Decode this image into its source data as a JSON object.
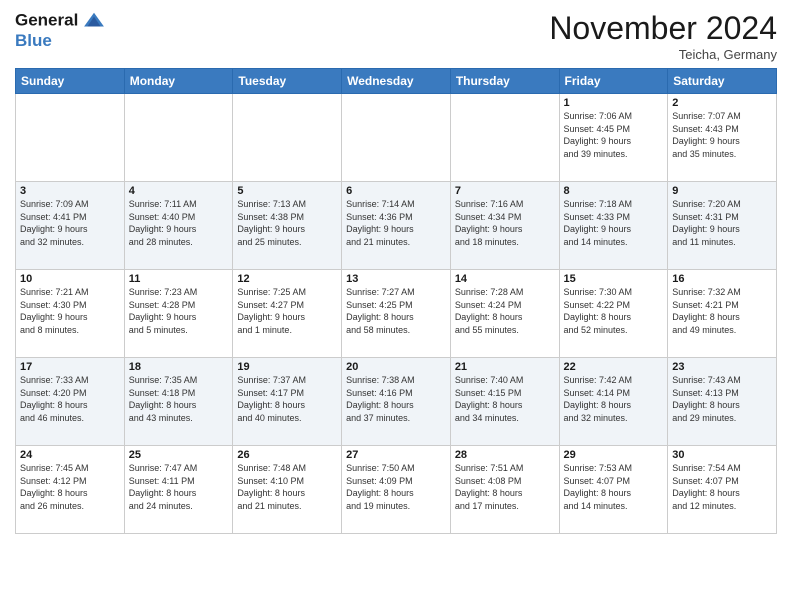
{
  "header": {
    "logo_line1": "General",
    "logo_line2": "Blue",
    "month": "November 2024",
    "location": "Teicha, Germany"
  },
  "weekdays": [
    "Sunday",
    "Monday",
    "Tuesday",
    "Wednesday",
    "Thursday",
    "Friday",
    "Saturday"
  ],
  "weeks": [
    [
      {
        "day": "",
        "info": ""
      },
      {
        "day": "",
        "info": ""
      },
      {
        "day": "",
        "info": ""
      },
      {
        "day": "",
        "info": ""
      },
      {
        "day": "",
        "info": ""
      },
      {
        "day": "1",
        "info": "Sunrise: 7:06 AM\nSunset: 4:45 PM\nDaylight: 9 hours\nand 39 minutes."
      },
      {
        "day": "2",
        "info": "Sunrise: 7:07 AM\nSunset: 4:43 PM\nDaylight: 9 hours\nand 35 minutes."
      }
    ],
    [
      {
        "day": "3",
        "info": "Sunrise: 7:09 AM\nSunset: 4:41 PM\nDaylight: 9 hours\nand 32 minutes."
      },
      {
        "day": "4",
        "info": "Sunrise: 7:11 AM\nSunset: 4:40 PM\nDaylight: 9 hours\nand 28 minutes."
      },
      {
        "day": "5",
        "info": "Sunrise: 7:13 AM\nSunset: 4:38 PM\nDaylight: 9 hours\nand 25 minutes."
      },
      {
        "day": "6",
        "info": "Sunrise: 7:14 AM\nSunset: 4:36 PM\nDaylight: 9 hours\nand 21 minutes."
      },
      {
        "day": "7",
        "info": "Sunrise: 7:16 AM\nSunset: 4:34 PM\nDaylight: 9 hours\nand 18 minutes."
      },
      {
        "day": "8",
        "info": "Sunrise: 7:18 AM\nSunset: 4:33 PM\nDaylight: 9 hours\nand 14 minutes."
      },
      {
        "day": "9",
        "info": "Sunrise: 7:20 AM\nSunset: 4:31 PM\nDaylight: 9 hours\nand 11 minutes."
      }
    ],
    [
      {
        "day": "10",
        "info": "Sunrise: 7:21 AM\nSunset: 4:30 PM\nDaylight: 9 hours\nand 8 minutes."
      },
      {
        "day": "11",
        "info": "Sunrise: 7:23 AM\nSunset: 4:28 PM\nDaylight: 9 hours\nand 5 minutes."
      },
      {
        "day": "12",
        "info": "Sunrise: 7:25 AM\nSunset: 4:27 PM\nDaylight: 9 hours\nand 1 minute."
      },
      {
        "day": "13",
        "info": "Sunrise: 7:27 AM\nSunset: 4:25 PM\nDaylight: 8 hours\nand 58 minutes."
      },
      {
        "day": "14",
        "info": "Sunrise: 7:28 AM\nSunset: 4:24 PM\nDaylight: 8 hours\nand 55 minutes."
      },
      {
        "day": "15",
        "info": "Sunrise: 7:30 AM\nSunset: 4:22 PM\nDaylight: 8 hours\nand 52 minutes."
      },
      {
        "day": "16",
        "info": "Sunrise: 7:32 AM\nSunset: 4:21 PM\nDaylight: 8 hours\nand 49 minutes."
      }
    ],
    [
      {
        "day": "17",
        "info": "Sunrise: 7:33 AM\nSunset: 4:20 PM\nDaylight: 8 hours\nand 46 minutes."
      },
      {
        "day": "18",
        "info": "Sunrise: 7:35 AM\nSunset: 4:18 PM\nDaylight: 8 hours\nand 43 minutes."
      },
      {
        "day": "19",
        "info": "Sunrise: 7:37 AM\nSunset: 4:17 PM\nDaylight: 8 hours\nand 40 minutes."
      },
      {
        "day": "20",
        "info": "Sunrise: 7:38 AM\nSunset: 4:16 PM\nDaylight: 8 hours\nand 37 minutes."
      },
      {
        "day": "21",
        "info": "Sunrise: 7:40 AM\nSunset: 4:15 PM\nDaylight: 8 hours\nand 34 minutes."
      },
      {
        "day": "22",
        "info": "Sunrise: 7:42 AM\nSunset: 4:14 PM\nDaylight: 8 hours\nand 32 minutes."
      },
      {
        "day": "23",
        "info": "Sunrise: 7:43 AM\nSunset: 4:13 PM\nDaylight: 8 hours\nand 29 minutes."
      }
    ],
    [
      {
        "day": "24",
        "info": "Sunrise: 7:45 AM\nSunset: 4:12 PM\nDaylight: 8 hours\nand 26 minutes."
      },
      {
        "day": "25",
        "info": "Sunrise: 7:47 AM\nSunset: 4:11 PM\nDaylight: 8 hours\nand 24 minutes."
      },
      {
        "day": "26",
        "info": "Sunrise: 7:48 AM\nSunset: 4:10 PM\nDaylight: 8 hours\nand 21 minutes."
      },
      {
        "day": "27",
        "info": "Sunrise: 7:50 AM\nSunset: 4:09 PM\nDaylight: 8 hours\nand 19 minutes."
      },
      {
        "day": "28",
        "info": "Sunrise: 7:51 AM\nSunset: 4:08 PM\nDaylight: 8 hours\nand 17 minutes."
      },
      {
        "day": "29",
        "info": "Sunrise: 7:53 AM\nSunset: 4:07 PM\nDaylight: 8 hours\nand 14 minutes."
      },
      {
        "day": "30",
        "info": "Sunrise: 7:54 AM\nSunset: 4:07 PM\nDaylight: 8 hours\nand 12 minutes."
      }
    ]
  ]
}
